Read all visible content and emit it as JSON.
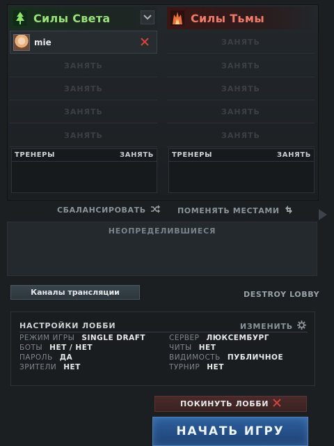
{
  "radiant": {
    "title": "Силы Света",
    "player": {
      "name": "mie"
    },
    "empty_slot_label": "ЗАНЯТЬ",
    "coaches": {
      "label": "ТРЕНЕРЫ",
      "take": "ЗАНЯТЬ"
    },
    "color": "#9ce27a",
    "icon": "radiant-tree-icon"
  },
  "dire": {
    "title": "Силы Тьмы",
    "empty_slot_label": "ЗАНЯТЬ",
    "coaches": {
      "label": "ТРЕНЕРЫ",
      "take": "ЗАНЯТЬ"
    },
    "color": "#ef7b6b",
    "icon": "dire-tower-icon"
  },
  "actions": {
    "balance": "СБАЛАНСИРОВАТЬ",
    "swap": "ПОМЕНЯТЬ МЕСТАМИ"
  },
  "unassigned": {
    "label": "НЕОПРЕДЕЛИВШИЕСЯ"
  },
  "broadcast_button": "Каналы трансляции",
  "destroy_lobby": "DESTROY LOBBY",
  "settings": {
    "title": "НАСТРОЙКИ ЛОББИ",
    "edit": "ИЗМЕНИТЬ",
    "rows": [
      {
        "key": "РЕЖИМ ИГРЫ",
        "value": "SINGLE DRAFT"
      },
      {
        "key": "БОТЫ",
        "value": "НЕТ / НЕТ"
      },
      {
        "key": "ПАРОЛЬ",
        "value": "ДА"
      },
      {
        "key": "ЗРИТЕЛИ",
        "value": "НЕТ"
      },
      {
        "key": "СЕРВЕР",
        "value": "ЛЮКСЕМБУРГ"
      },
      {
        "key": "ЧИТЫ",
        "value": "НЕТ"
      },
      {
        "key": "ВИДИМОСТЬ",
        "value": "ПУБЛИЧНОЕ"
      },
      {
        "key": "ТУРНИР",
        "value": "НЕТ"
      }
    ]
  },
  "leave_button": "ПОКИНУТЬ ЛОББИ",
  "start_button": "НАЧАТЬ ИГРУ"
}
